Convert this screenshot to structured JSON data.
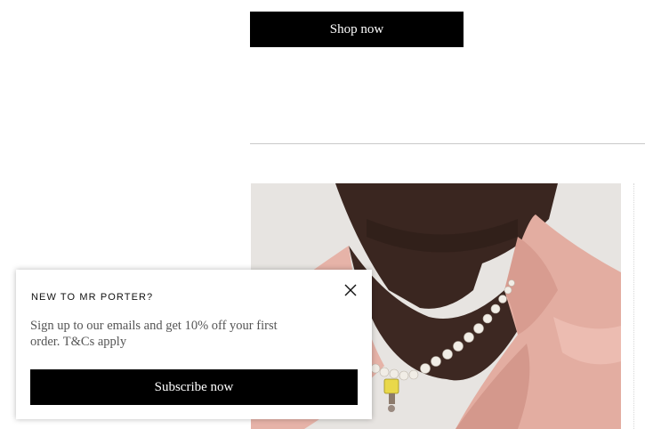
{
  "hero": {
    "shop_label": "Shop now"
  },
  "product": {
    "image_colors": {
      "background": "#e7e4e1",
      "skin": "#3a2620",
      "shirt": "#e6b3a8",
      "pearl": "#f1ede6",
      "pendant": "#e9d84a"
    }
  },
  "popup": {
    "heading": "NEW TO MR PORTER?",
    "body": "Sign up to our emails and get 10% off your first order. T&Cs apply",
    "subscribe_label": "Subscribe now",
    "close_icon": "close-icon"
  }
}
